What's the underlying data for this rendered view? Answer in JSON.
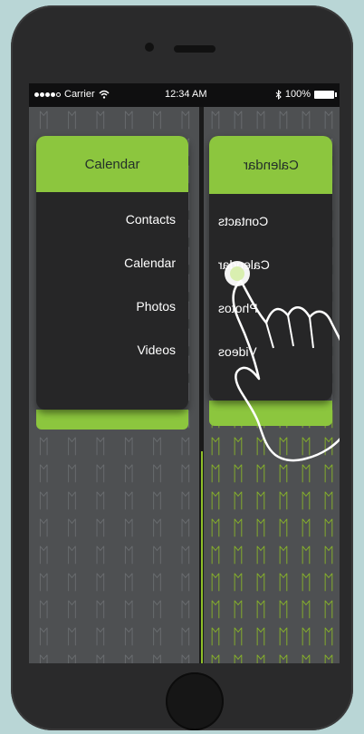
{
  "status_bar": {
    "carrier": "Carrier",
    "time": "12:34 AM",
    "battery": "100%",
    "bluetooth_icon": "bluetooth-icon",
    "wifi_icon": "wifi-icon"
  },
  "left_menu": {
    "header": "Calendar",
    "items": [
      "Contacts",
      "Calendar",
      "Photos",
      "Videos"
    ]
  },
  "right_menu": {
    "header": "Calendar",
    "items": [
      "Contacts",
      "Calendar",
      "Photos",
      "Videos"
    ]
  },
  "pattern_glyph": "ᛖ",
  "colors": {
    "accent_green": "#8cc63e",
    "card_dark": "#262627",
    "screen_bg": "#4e5052"
  }
}
